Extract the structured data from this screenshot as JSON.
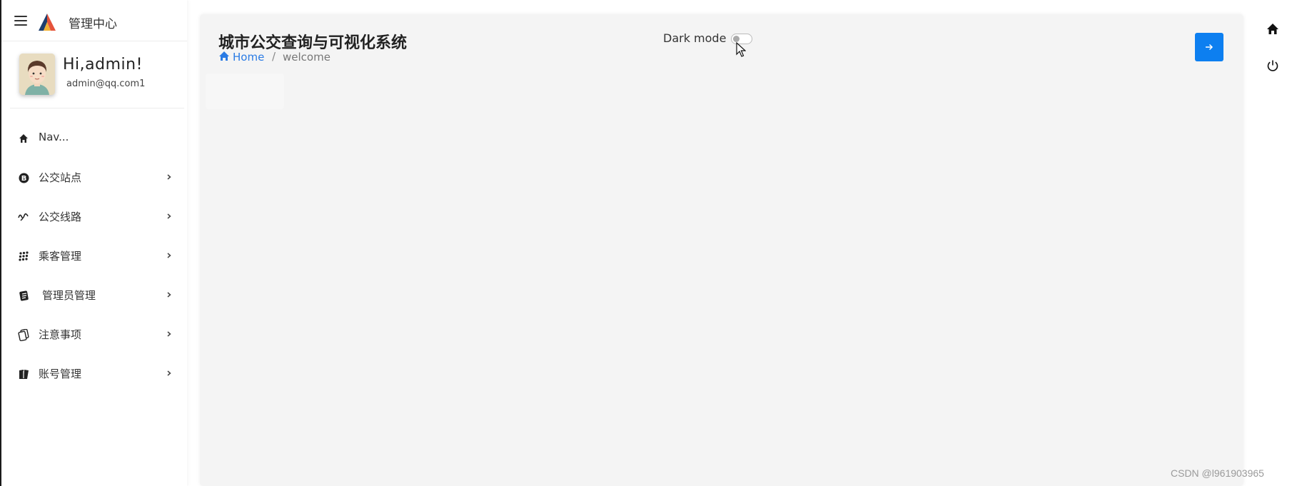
{
  "brand": {
    "title": "管理中心"
  },
  "profile": {
    "greeting": "Hi,admin!",
    "email": "admin@qq.com1"
  },
  "nav": {
    "items": [
      {
        "label": "Nav...",
        "icon": "home-icon",
        "has_children": false
      },
      {
        "label": "公交站点",
        "icon": "bus-stop-icon",
        "has_children": true
      },
      {
        "label": "公交线路",
        "icon": "route-icon",
        "has_children": true
      },
      {
        "label": "乘客管理",
        "icon": "grid-dots-icon",
        "has_children": true
      },
      {
        "label": "管理员管理",
        "icon": "notebook-icon",
        "has_children": true
      },
      {
        "label": "注意事项",
        "icon": "copy-icon",
        "has_children": true
      },
      {
        "label": "账号管理",
        "icon": "book-icon",
        "has_children": true
      }
    ]
  },
  "header": {
    "title": "城市公交查询与可视化系统",
    "breadcrumb": {
      "home": "Home",
      "separator": "/",
      "current": "welcome"
    },
    "dark_mode": {
      "label": "Dark mode",
      "enabled": false
    }
  },
  "right_rail": {
    "icons": [
      "home-icon",
      "power-icon"
    ]
  },
  "watermark": "CSDN @l961903965",
  "colors": {
    "accent": "#0d7ff0",
    "link": "#2a7be4",
    "card_bg": "#f4f4f4"
  }
}
